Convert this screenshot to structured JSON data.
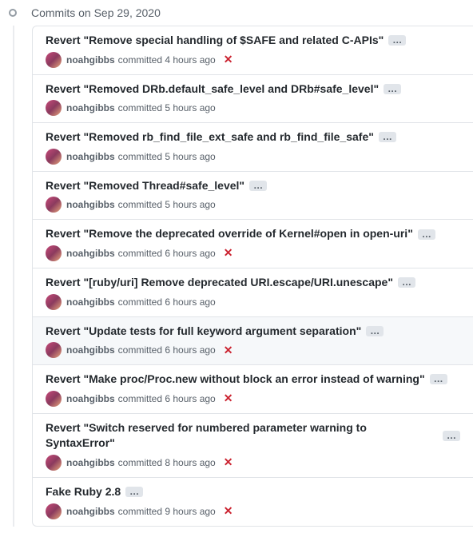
{
  "date_header": "Commits on Sep 29, 2020",
  "commits": [
    {
      "title": "Revert \"Remove special handling of $SAFE and related C-APIs\"",
      "author": "noahgibbs",
      "meta": "committed 4 hours ago",
      "status_failed": true,
      "highlighted": false
    },
    {
      "title": "Revert \"Removed DRb.default_safe_level and DRb#safe_level\"",
      "author": "noahgibbs",
      "meta": "committed 5 hours ago",
      "status_failed": false,
      "highlighted": false
    },
    {
      "title": "Revert \"Removed rb_find_file_ext_safe and rb_find_file_safe\"",
      "author": "noahgibbs",
      "meta": "committed 5 hours ago",
      "status_failed": false,
      "highlighted": false
    },
    {
      "title": "Revert \"Removed Thread#safe_level\"",
      "author": "noahgibbs",
      "meta": "committed 5 hours ago",
      "status_failed": false,
      "highlighted": false
    },
    {
      "title": "Revert \"Remove the deprecated override of Kernel#open in open-uri\"",
      "author": "noahgibbs",
      "meta": "committed 6 hours ago",
      "status_failed": true,
      "highlighted": false
    },
    {
      "title": "Revert \"[ruby/uri] Remove deprecated URI.escape/URI.unescape\"",
      "author": "noahgibbs",
      "meta": "committed 6 hours ago",
      "status_failed": false,
      "highlighted": false
    },
    {
      "title": "Revert \"Update tests for full keyword argument separation\"",
      "author": "noahgibbs",
      "meta": "committed 6 hours ago",
      "status_failed": true,
      "highlighted": true
    },
    {
      "title": "Revert \"Make proc/Proc.new without block an error instead of warning\"",
      "author": "noahgibbs",
      "meta": "committed 6 hours ago",
      "status_failed": true,
      "highlighted": false
    },
    {
      "title": "Revert \"Switch reserved for numbered parameter warning to SyntaxError\"",
      "author": "noahgibbs",
      "meta": "committed 8 hours ago",
      "status_failed": true,
      "highlighted": false
    },
    {
      "title": "Fake Ruby 2.8",
      "author": "noahgibbs",
      "meta": "committed 9 hours ago",
      "status_failed": true,
      "highlighted": false
    }
  ],
  "ellipsis_label": "…",
  "status_x_glyph": "✕"
}
